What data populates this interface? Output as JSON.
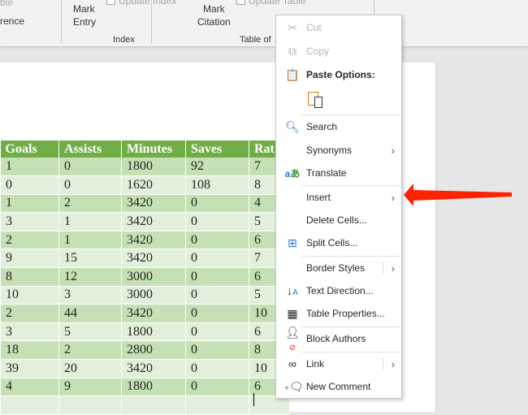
{
  "ribbon": {
    "frag_top": "ble",
    "frag_ref": "rence",
    "mark_entry": [
      "Mark",
      "Entry"
    ],
    "update_index": "Update Index",
    "index_group": "Index",
    "mark_citation": [
      "Mark",
      "Citation"
    ],
    "update_table": "Update Table",
    "table_group": "Table of"
  },
  "table": {
    "headers": [
      "Goals",
      "Assists",
      "Minutes",
      "Saves",
      "Rat"
    ],
    "rows": [
      [
        "1",
        "0",
        "1800",
        "92",
        "7"
      ],
      [
        "0",
        "0",
        "1620",
        "108",
        "8"
      ],
      [
        "1",
        "2",
        "3420",
        "0",
        "4"
      ],
      [
        "3",
        "1",
        "3420",
        "0",
        "5"
      ],
      [
        "2",
        "1",
        "3420",
        "0",
        "6"
      ],
      [
        "9",
        "15",
        "3420",
        "0",
        "7"
      ],
      [
        "8",
        "12",
        "3000",
        "0",
        "6"
      ],
      [
        "10",
        "3",
        "3000",
        "0",
        "5"
      ],
      [
        "2",
        "44",
        "3420",
        "0",
        "10"
      ],
      [
        "3",
        "5",
        "1800",
        "0",
        "6"
      ],
      [
        "18",
        "2",
        "2800",
        "0",
        "8"
      ],
      [
        "39",
        "20",
        "3420",
        "0",
        "10"
      ],
      [
        "4",
        "9",
        "1800",
        "0",
        "6"
      ],
      [
        "",
        "",
        "",
        "",
        ""
      ]
    ]
  },
  "menu": {
    "items": [
      {
        "label": "Cut",
        "icon": "scissors-icon",
        "disabled": true
      },
      {
        "label": "Copy",
        "icon": "copy-icon",
        "disabled": true
      },
      {
        "label": "Paste Options:",
        "icon": "paste-icon"
      },
      {
        "label": "Search",
        "icon": "search-icon"
      },
      {
        "label": "Synonyms",
        "submenu": true
      },
      {
        "label": "Translate",
        "icon": "translate-icon"
      },
      {
        "label": "Insert",
        "submenu": true
      },
      {
        "label": "Delete Cells..."
      },
      {
        "label": "Split Cells...",
        "icon": "split-cells-icon"
      },
      {
        "label": "Border Styles",
        "submenu": true
      },
      {
        "label": "Text Direction...",
        "icon": "text-direction-icon"
      },
      {
        "label": "Table Properties...",
        "icon": "table-properties-icon"
      },
      {
        "label": "Block Authors",
        "icon": "block-authors-icon"
      },
      {
        "label": "Link",
        "icon": "link-icon",
        "submenu": true
      },
      {
        "label": "New Comment",
        "icon": "new-comment-icon"
      }
    ]
  },
  "annotation": {
    "arrow_color": "#ff2200"
  },
  "colors": {
    "header": "#70ad47",
    "row_dark": "#c5e0b4",
    "row_light": "#e2efda"
  }
}
